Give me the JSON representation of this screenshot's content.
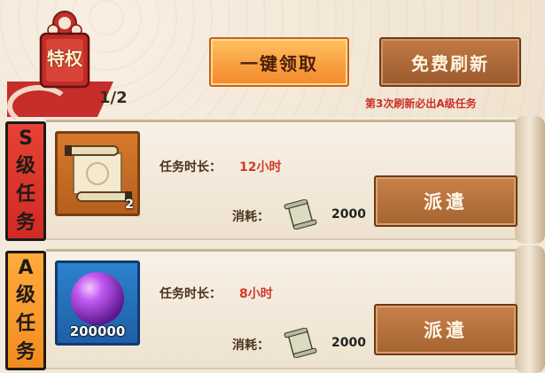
{
  "header": {
    "privilege_badge": "特权",
    "counter": "1/2",
    "claim_all_button": "一键领取",
    "free_refresh_button": "免费刷新",
    "refresh_tip": "第3次刷新必出A级任务"
  },
  "missions": [
    {
      "grade": [
        "S",
        "级",
        "任",
        "务"
      ],
      "item_count": "2",
      "duration_label": "任务时长：",
      "duration_value": "12小时",
      "cost_label": "消耗：",
      "cost_value": "2000",
      "dispatch_button": "派遣"
    },
    {
      "grade": [
        "A",
        "级",
        "任",
        "务"
      ],
      "item_count": "200000",
      "duration_label": "任务时长：",
      "duration_value": "8小时",
      "cost_label": "消耗：",
      "cost_value": "2000",
      "dispatch_button": "派遣"
    }
  ],
  "colors": {
    "accent_orange": "#f2882a",
    "brown_button": "#a4632f",
    "grade_s": "#d22a24",
    "grade_a": "#f28c1f",
    "tip_red": "#cc3025"
  },
  "icons": [
    "privilege-badge-icon",
    "scroll-item-icon",
    "purple-orb-icon",
    "scroll-cost-icon"
  ]
}
